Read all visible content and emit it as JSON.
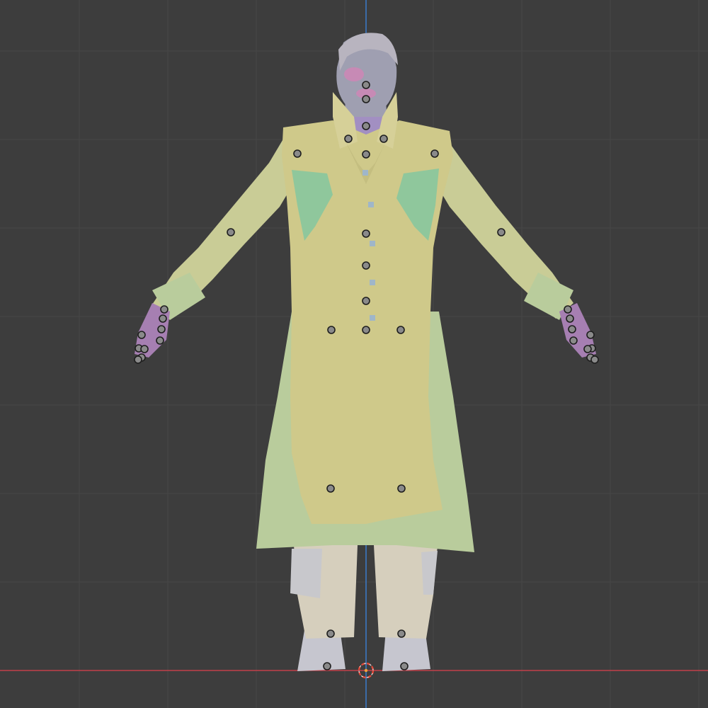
{
  "viewport": {
    "view": "front-orthographic",
    "background_color": "#3d3d3d",
    "grid_color": "#474747",
    "axis_x_color": "#c2404a",
    "axis_z_color": "#3b78c4"
  },
  "model": {
    "icon": "rigged-character-mesh",
    "coat_color": "#cfc98a",
    "inner_coat_color": "#b9cc9c",
    "pocket_color": "#8fc79c",
    "skin_color": "#9f9fb1",
    "hands_color": "#a67fb2",
    "pants_color": "#d6cfbd",
    "boots_color": "#c6c6cf"
  },
  "gizmo": {
    "icon": "3d-cursor-icon",
    "ring_color": "#e24a3a"
  },
  "bone_joint_color": "#8a8a8a"
}
